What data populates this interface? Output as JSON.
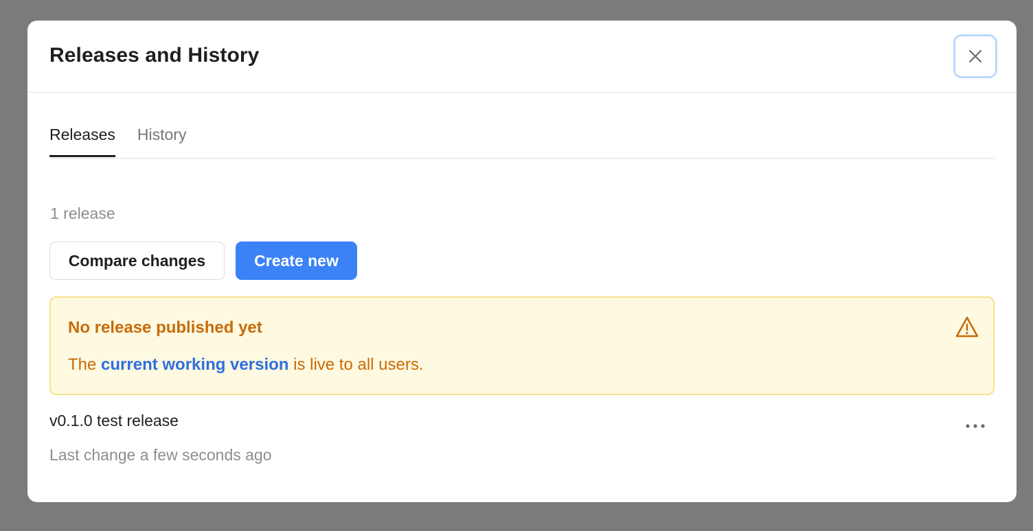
{
  "dialog": {
    "title": "Releases and History",
    "close_icon": "close-icon"
  },
  "tabs": [
    {
      "label": "Releases",
      "active": true
    },
    {
      "label": "History",
      "active": false
    }
  ],
  "releases": {
    "count_label": "1 release",
    "compare_button": "Compare changes",
    "create_button": "Create new",
    "warning": {
      "title": "No release published yet",
      "body_prefix": "The ",
      "body_link": "current working version",
      "body_suffix": " is live to all users.",
      "icon": "warning-triangle-icon"
    },
    "items": [
      {
        "name": "v0.1.0 test release",
        "meta": "Last change a few seconds ago",
        "menu_icon": "more-horizontal-icon"
      }
    ]
  },
  "colors": {
    "primary": "#3b82f6",
    "warning_text": "#c86b08",
    "warning_bg": "#fef9e1",
    "link": "#2f6fe0"
  }
}
